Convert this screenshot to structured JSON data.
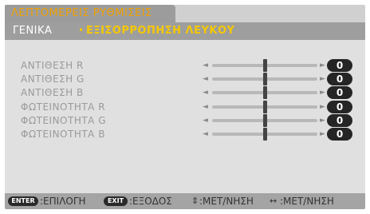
{
  "title": "ΛΕΠΤΟΜΕΡΕΙΣ ΡΥΘΜΙΣΕΙΣ",
  "breadcrumb": {
    "parent": "ΓΕΝΙΚΑ",
    "separator": "•",
    "current": "ΕΞΙΣΟΡΡΟΠΗΣΗ ΛΕΥΚΟΥ"
  },
  "settings": [
    {
      "label": "ΑΝΤΙΘΕΣΗ R",
      "value": "0",
      "level": 0.5
    },
    {
      "label": "ΑΝΤΙΘΕΣΗ G",
      "value": "0",
      "level": 0.5
    },
    {
      "label": "ΑΝΤΙΘΕΣΗ B",
      "value": "0",
      "level": 0.5
    },
    {
      "label": "ΦΩΤΕΙΝΟΤΗΤΑ R",
      "value": "0",
      "level": 0.5
    },
    {
      "label": "ΦΩΤΕΙΝΟΤΗΤΑ G",
      "value": "0",
      "level": 0.5
    },
    {
      "label": "ΦΩΤΕΙΝΟΤΗΤΑ B",
      "value": "0",
      "level": 0.5
    }
  ],
  "arrows": {
    "left": "◄",
    "right": "►"
  },
  "footer": {
    "enter_key": "ENTER",
    "enter_text": ":ΕΠΙΛΟΓΗ",
    "exit_key": "EXIT",
    "exit_text": ":ΕΞΟΔΟΣ",
    "updown_glyph": "⇕",
    "updown_text": ":ΜΕΤ/ΝΗΣΗ",
    "leftright_glyph": "↔",
    "leftright_text": ":ΜΕΤ/ΝΗΣΗ"
  },
  "colors": {
    "title": "#f0a000",
    "breadcrumb_current": "#f5c800",
    "value_pill": "#252525"
  }
}
